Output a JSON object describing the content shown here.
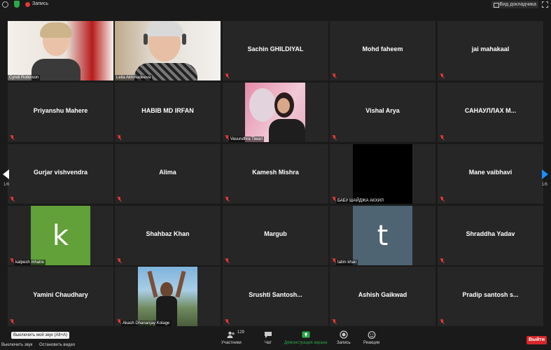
{
  "topbar": {
    "recording_label": "Запись",
    "view_label": "Вид докладчика"
  },
  "pagination": {
    "left_page": "1/6",
    "right_page": "1/6"
  },
  "participants": [
    {
      "name": "Cyndi Robinson",
      "type": "video"
    },
    {
      "name": "Leila Akhmadeeva",
      "type": "video",
      "active": true
    },
    {
      "name": "Sachin GHILDIYAL",
      "type": "name"
    },
    {
      "name": "Mohd faheem",
      "type": "name"
    },
    {
      "name": "jai mahakaal",
      "type": "name"
    },
    {
      "name": "Priyanshu Mahere",
      "type": "name"
    },
    {
      "name": "HABIB MD IRFAN",
      "type": "name"
    },
    {
      "name": "Vasundhra Tiwari",
      "type": "video"
    },
    {
      "name": "Vishal Arya",
      "type": "name"
    },
    {
      "name": "САНАУЛЛАХ  М...",
      "type": "name"
    },
    {
      "name": "Gurjar vishvendra",
      "type": "name"
    },
    {
      "name": "Alima",
      "type": "name"
    },
    {
      "name": "Kamesh Mishra",
      "type": "name"
    },
    {
      "name": "БАБУ ШАЙДЖА АКХИЛ",
      "type": "black"
    },
    {
      "name": "Mane vaibhavi",
      "type": "name"
    },
    {
      "name": "kalpesh mhatre",
      "type": "avatar",
      "letter": "k",
      "color": "#62a03a"
    },
    {
      "name": "Shahbaz Khan",
      "type": "name"
    },
    {
      "name": "Margub",
      "type": "name"
    },
    {
      "name": "talim khan",
      "type": "avatar",
      "letter": "t",
      "color": "#4e6472"
    },
    {
      "name": "Shraddha Yadav",
      "type": "name"
    },
    {
      "name": "Yamini Chaudhary",
      "type": "name"
    },
    {
      "name": "Akash Dhananjay Kolage",
      "type": "video"
    },
    {
      "name": "Srushti  Santosh...",
      "type": "name"
    },
    {
      "name": "Ashish Gaikwad",
      "type": "name"
    },
    {
      "name": "Pradip santosh s...",
      "type": "name"
    }
  ],
  "toolbar": {
    "tooltip": "Выключить мой звук (Alt+A)",
    "mute_label": "Выключить звук",
    "video_label": "Остановить видео",
    "participants_count": "129",
    "participants_label": "Участники",
    "chat_label": "Чат",
    "share_label": "Демонстрация экрана",
    "record_label": "Запись",
    "reactions_label": "Реакции",
    "leave_label": "Выйти"
  },
  "colors": {
    "share": "#2ca84a",
    "leave": "#d7262b",
    "active_border": "#e4e060",
    "accent": "#1e8cff"
  }
}
